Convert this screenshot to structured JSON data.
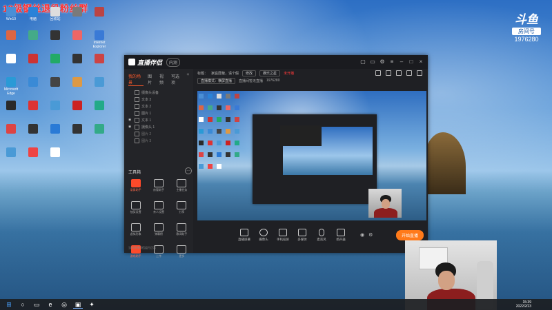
{
  "overlay": {
    "title": "18级钢丝退役粉丝群"
  },
  "brand": {
    "logo": "斗鱼",
    "room_label": "房间号",
    "room_number": "1976280"
  },
  "desktop_icons": [
    {
      "label": "Win10",
      "color": "#4a8fd6"
    },
    {
      "label": "电脑",
      "color": "#2a82d8"
    },
    {
      "label": "回收站",
      "color": "#dddddd"
    },
    {
      "label": "",
      "color": "#7a7a7a"
    },
    {
      "label": "",
      "color": "#b44"
    },
    {
      "label": "",
      "color": "#d64"
    },
    {
      "label": "",
      "color": "#4a8"
    },
    {
      "label": "",
      "color": "#333"
    },
    {
      "label": "",
      "color": "#e66"
    },
    {
      "label": "Internet Explorer",
      "color": "#3a7ad6"
    },
    {
      "label": "",
      "color": "#fff"
    },
    {
      "label": "",
      "color": "#c33"
    },
    {
      "label": "",
      "color": "#2a6"
    },
    {
      "label": "",
      "color": "#333"
    },
    {
      "label": "",
      "color": "#c44"
    },
    {
      "label": "Microsoft Edge",
      "color": "#2a9ad6"
    },
    {
      "label": "",
      "color": "#3a8ad6"
    },
    {
      "label": "",
      "color": "#444"
    },
    {
      "label": "",
      "color": "#d94"
    },
    {
      "label": "",
      "color": "#4a9ad6"
    },
    {
      "label": "",
      "color": "#2a2a2a"
    },
    {
      "label": "",
      "color": "#d33"
    },
    {
      "label": "",
      "color": "#4a9ad6"
    },
    {
      "label": "",
      "color": "#c22"
    },
    {
      "label": "",
      "color": "#2a8"
    },
    {
      "label": "",
      "color": "#d44"
    },
    {
      "label": "",
      "color": "#333"
    },
    {
      "label": "",
      "color": "#2a7ad6"
    },
    {
      "label": "",
      "color": "#333"
    },
    {
      "label": "",
      "color": "#3a8"
    },
    {
      "label": "",
      "color": "#4a9ad6"
    },
    {
      "label": "",
      "color": "#e44"
    },
    {
      "label": "",
      "color": "#fff"
    }
  ],
  "app": {
    "name": "直播伴侣",
    "badge": "内测",
    "tabs": [
      "我的场景",
      "图片",
      "视频",
      "可选项"
    ],
    "sources": [
      {
        "label": "摄像头设备"
      },
      {
        "label": "文本 3"
      },
      {
        "label": "文本 2"
      },
      {
        "label": "图片 1"
      },
      {
        "label": "文本 1"
      },
      {
        "label": "摄像头 1"
      },
      {
        "label": "图片 2"
      },
      {
        "label": "图片 3"
      }
    ],
    "tools_title": "工具箱",
    "tools": [
      {
        "label": "录屏助手",
        "hot": true
      },
      {
        "label": "房管助手"
      },
      {
        "label": "主播任务"
      },
      {
        "label": "抽奖设置"
      },
      {
        "label": "亲人设置"
      },
      {
        "label": "分享"
      },
      {
        "label": "虚拟形象"
      },
      {
        "label": "弹幕榜"
      },
      {
        "label": "歌词助手"
      },
      {
        "label": "游戏助手",
        "hot": true
      },
      {
        "label": "上传"
      },
      {
        "label": "更多"
      }
    ],
    "footer": "当前直播伴侣运行正常",
    "info1": {
      "title_prefix": "标题：",
      "title": "家庭屏蔽，请个假",
      "edit": "修改",
      "category": "娱乐之星",
      "warning": "未开播"
    },
    "info2": {
      "mode": "直播模式：横屏直播",
      "notice": "直播间暂无直播",
      "room": "1976280"
    },
    "bottom_actions": [
      "直播屏幕",
      "摄像头",
      "手机投屏",
      "多媒体",
      "麦克风",
      "扬声器"
    ],
    "go_live": "开始直播"
  },
  "taskbar": {
    "time": "15:39",
    "date": "2022/2/23"
  }
}
